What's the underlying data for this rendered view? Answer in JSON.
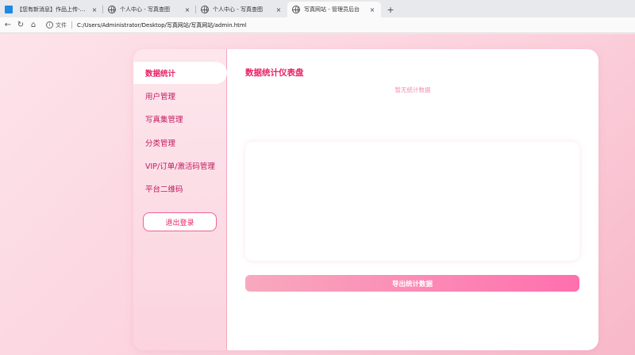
{
  "browser": {
    "tabs": [
      {
        "title": "【您有新消息】作品上传-程序员..."
      },
      {
        "title": "个人中心 - 写真查图"
      },
      {
        "title": "个人中心 - 写真查图"
      },
      {
        "title": "写真网站 - 管理员后台"
      }
    ],
    "new_tab": "+",
    "close_glyph": "×",
    "address": {
      "file_label": "文件",
      "url": "C:/Users/Administrator/Desktop/写真网站/写真网站/admin.html"
    }
  },
  "sidebar": {
    "items": [
      {
        "label": "数据统计"
      },
      {
        "label": "用户管理"
      },
      {
        "label": "写真集管理"
      },
      {
        "label": "分类管理"
      },
      {
        "label": "VIP/订单/激活码管理"
      },
      {
        "label": "平台二维码"
      }
    ],
    "logout_label": "退出登录"
  },
  "main": {
    "title": "数据统计仪表盘",
    "empty_text": "暂无统计数据",
    "export_label": "导出统计数据"
  },
  "colors": {
    "accent": "#e91e63",
    "panel_border": "#f5a9bf"
  }
}
